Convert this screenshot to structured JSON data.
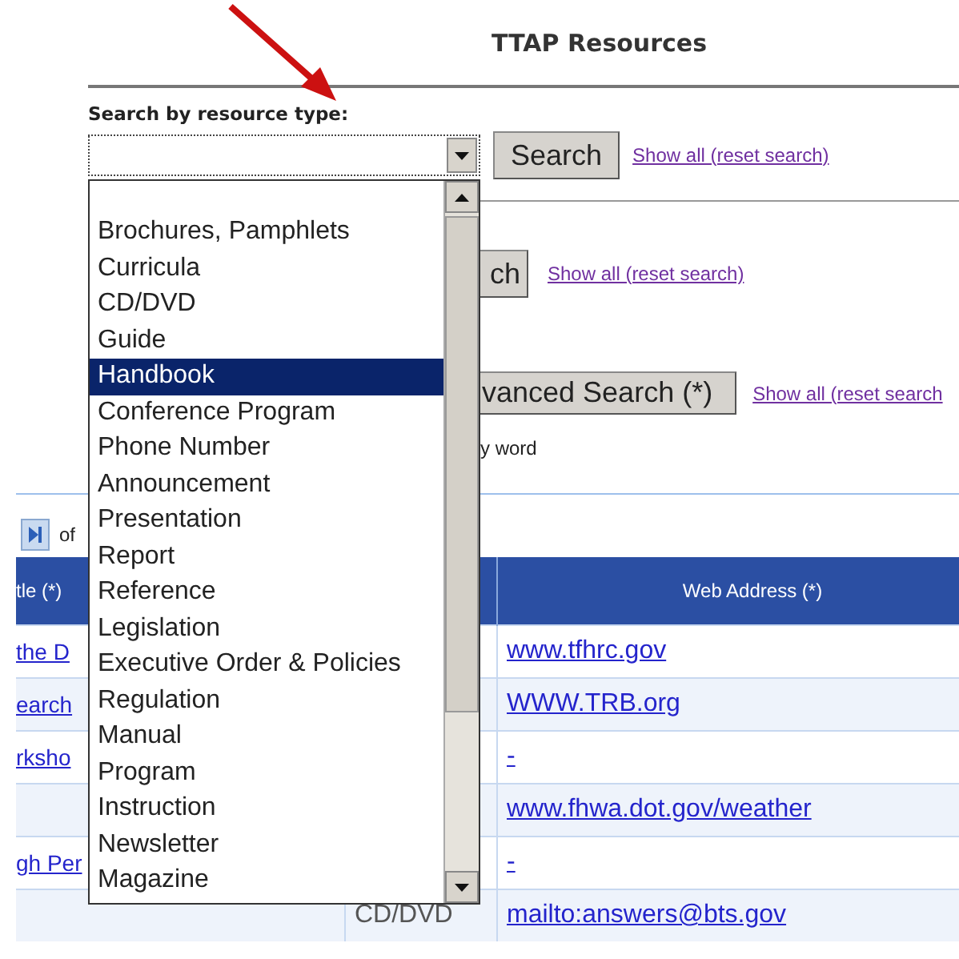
{
  "title": "TTAP Resources",
  "search": {
    "label": "Search by resource type:",
    "button": "Search",
    "reset_link": "Show all (reset search)"
  },
  "dropdown": {
    "options": [
      {
        "label": "Brochures, Pamphlets",
        "selected": false
      },
      {
        "label": "Curricula",
        "selected": false
      },
      {
        "label": "CD/DVD",
        "selected": false
      },
      {
        "label": "Guide",
        "selected": false
      },
      {
        "label": "Handbook",
        "selected": true
      },
      {
        "label": "Conference Program",
        "selected": false
      },
      {
        "label": "Phone Number",
        "selected": false
      },
      {
        "label": "Announcement",
        "selected": false
      },
      {
        "label": "Presentation",
        "selected": false
      },
      {
        "label": "Report",
        "selected": false
      },
      {
        "label": "Reference",
        "selected": false
      },
      {
        "label": "Legislation",
        "selected": false
      },
      {
        "label": "Executive Order & Policies",
        "selected": false
      },
      {
        "label": "Regulation",
        "selected": false
      },
      {
        "label": "Manual",
        "selected": false
      },
      {
        "label": "Program",
        "selected": false
      },
      {
        "label": "Instruction",
        "selected": false
      },
      {
        "label": "Newsletter",
        "selected": false
      },
      {
        "label": "Magazine",
        "selected": false
      }
    ]
  },
  "keyword_search": {
    "button": "ch",
    "reset_link": "Show all (reset search)"
  },
  "advanced_search": {
    "button": "vanced Search (*)",
    "reset_link": "Show all (reset search",
    "hint": "y word"
  },
  "pager": {
    "text": "of"
  },
  "table": {
    "header": {
      "column_1": "tle (*)",
      "web_address": "Web Address (*)"
    },
    "rows": [
      {
        "column_1": "the D",
        "web_address": "www.tfhrc.gov"
      },
      {
        "column_1": "earch",
        "web_address": "WWW.TRB.org"
      },
      {
        "column_1": "rksho",
        "web_address": "-"
      },
      {
        "web_address": "www.fhwa.dot.gov/weather"
      },
      {
        "column_1": "gh Per",
        "web_address": "-"
      },
      {
        "column_2": "CD/DVD",
        "web_address": "mailto:answers@bts.gov"
      }
    ]
  }
}
